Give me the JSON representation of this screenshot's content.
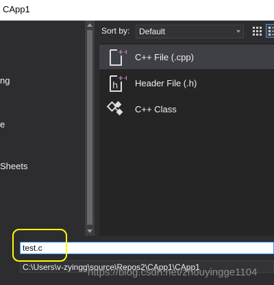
{
  "window": {
    "title": "CApp1"
  },
  "left_panel": {
    "items": [
      "ng",
      "e",
      "Sheets"
    ]
  },
  "sort": {
    "label": "Sort by:",
    "value": "Default"
  },
  "templates": [
    {
      "name": "C++ File (.cpp)",
      "icon": "cpp-file-icon",
      "selected": true
    },
    {
      "name": "Header File (.h)",
      "icon": "header-file-icon",
      "selected": false
    },
    {
      "name": "C++ Class",
      "icon": "cpp-class-icon",
      "selected": false
    }
  ],
  "name_field": {
    "value": "test.c"
  },
  "location_field": {
    "value": "C:\\Users\\v-zyingg\\source\\Repos2\\CApp1\\CApp1"
  },
  "watermark": "https://blog.csdn.net/zhouyingge1104",
  "colors": {
    "background": "#2d2d30",
    "accent": "#3399ff",
    "selection": "#3f3f46",
    "annotation": "#ffff00"
  }
}
